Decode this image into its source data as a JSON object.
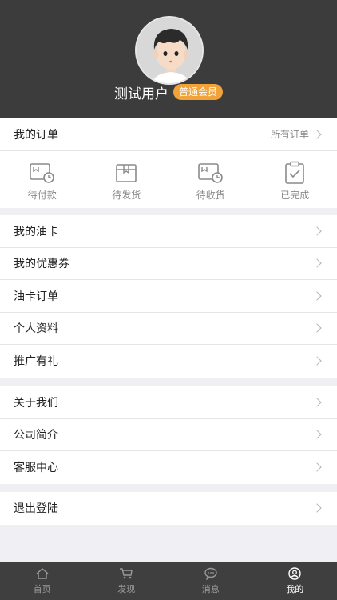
{
  "profile": {
    "username": "测试用户",
    "member_level": "普通会员",
    "avatar_icon": "avatar-cartoon-boy"
  },
  "orders": {
    "title": "我的订单",
    "all_link": "所有订单",
    "statuses": [
      {
        "label": "待付款",
        "icon": "wallet-clock-icon"
      },
      {
        "label": "待发货",
        "icon": "box-icon"
      },
      {
        "label": "待收货",
        "icon": "wallet-clock-icon"
      },
      {
        "label": "已完成",
        "icon": "clipboard-check-icon"
      }
    ]
  },
  "menu_group1": [
    {
      "label": "我的油卡"
    },
    {
      "label": "我的优惠券"
    },
    {
      "label": "油卡订单"
    },
    {
      "label": "个人资料"
    },
    {
      "label": "推广有礼"
    }
  ],
  "menu_group2": [
    {
      "label": "关于我们"
    },
    {
      "label": "公司简介"
    },
    {
      "label": "客服中心"
    }
  ],
  "logout": {
    "label": "退出登陆"
  },
  "tabbar": {
    "items": [
      {
        "label": "首页",
        "icon": "home-icon"
      },
      {
        "label": "发现",
        "icon": "cart-icon"
      },
      {
        "label": "消息",
        "icon": "chat-icon"
      },
      {
        "label": "我的",
        "icon": "user-icon",
        "active": true
      }
    ]
  },
  "colors": {
    "header_bg": "#3c3c3c",
    "badge": "#f1a33a",
    "tabbar_bg": "#3f3f3f",
    "page_bg": "#efeff4"
  }
}
